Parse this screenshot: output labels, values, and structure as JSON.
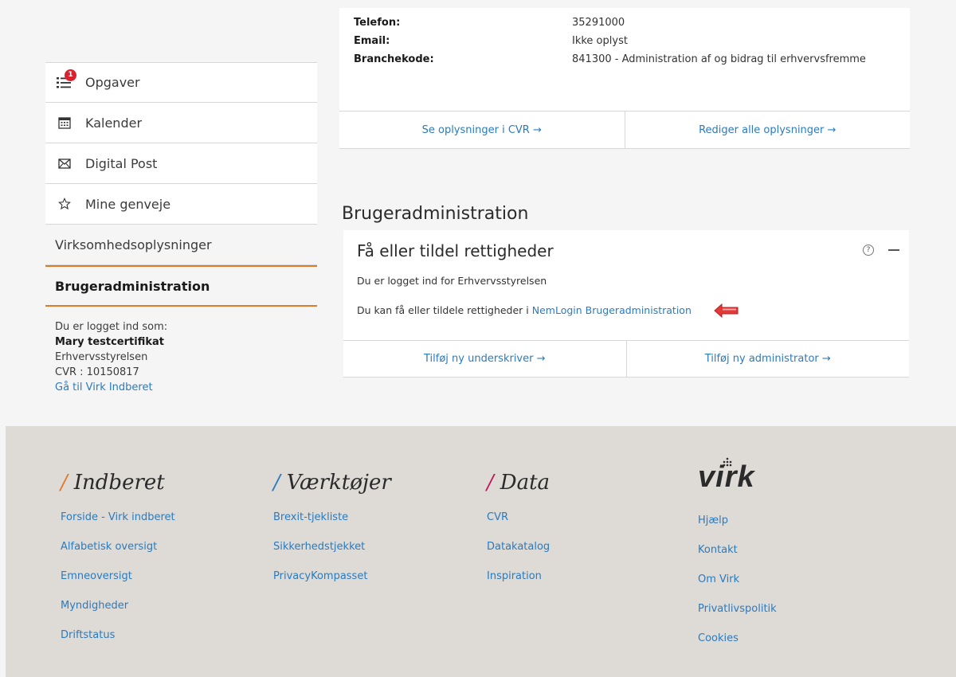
{
  "sidebar": {
    "items": [
      {
        "label": "Opgaver",
        "icon": "task-list-icon",
        "badge": "1"
      },
      {
        "label": "Kalender",
        "icon": "calendar-icon"
      },
      {
        "label": "Digital Post",
        "icon": "envelope-icon"
      },
      {
        "label": "Mine genveje",
        "icon": "star-icon"
      }
    ],
    "company_info": "Virksomhedsoplysninger",
    "user_admin": "Brugeradministration",
    "login": {
      "prefix": "Du er logget ind som:",
      "name": "Mary testcertifikat",
      "org": "Erhvervsstyrelsen",
      "cvr": "CVR : 10150817",
      "link": "Gå til Virk Indberet"
    }
  },
  "company": {
    "rows": [
      {
        "label": "Telefon:",
        "value": "35291000"
      },
      {
        "label": "Email:",
        "value": "Ikke oplyst"
      },
      {
        "label": "Branchekode:",
        "value": "841300 - Administration af og bidrag til erhvervsfremme"
      }
    ],
    "actions": [
      "Se oplysninger i CVR →",
      "Rediger alle oplysninger →"
    ]
  },
  "brugeradmin": {
    "section_title": "Brugeradministration",
    "card_title": "Få eller tildel rettigheder",
    "help_symbol": "?",
    "line1": "Du er logget ind for Erhvervsstyrelsen",
    "line2_prefix": "Du kan få eller tildele rettigheder i ",
    "line2_link": "NemLogin Brugeradministration",
    "actions": [
      "Tilføj ny underskriver →",
      "Tilføj ny administrator →"
    ]
  },
  "footer": {
    "columns": [
      {
        "slash": "/",
        "title": "Indberet",
        "slash_color": "#e07a2b",
        "links": [
          "Forside - Virk indberet",
          "Alfabetisk oversigt",
          "Emneoversigt",
          "Myndigheder",
          "Driftstatus"
        ]
      },
      {
        "slash": "/",
        "title": "Værktøjer",
        "slash_color": "#2a7bbf",
        "links": [
          "Brexit-tjekliste",
          "Sikkerhedstjekket",
          "PrivacyKompasset"
        ]
      },
      {
        "slash": "/",
        "title": "Data",
        "slash_color": "#c2185b",
        "links": [
          "CVR",
          "Datakatalog",
          "Inspiration"
        ]
      }
    ],
    "logo_text": "virk",
    "virk_links": [
      "Hjælp",
      "Kontakt",
      "Om Virk",
      "Privatlivspolitik",
      "Cookies"
    ]
  },
  "colors": {
    "accent": "#e07a2b",
    "link": "#2a7bbf",
    "badge": "#d9232e",
    "arrow": "#e03a3a"
  }
}
